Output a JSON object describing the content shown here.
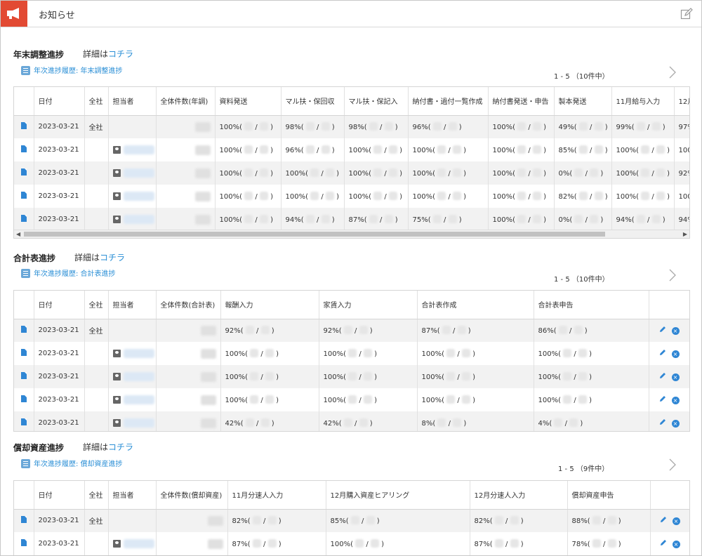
{
  "header": {
    "title": "お知らせ"
  },
  "sections": [
    {
      "title": "年末調整進捗",
      "detail_prefix": "詳細は",
      "detail_link": "コチラ",
      "history_link": "年次進捗履歴: 年末調整進捗",
      "pager": "1 - 5 （10件中）",
      "columns": [
        "日付",
        "全社",
        "担当者",
        "全体件数(年調)",
        "資料発送",
        "マル扶・保回収",
        "マル扶・保記入",
        "納付書・過付一覧作成",
        "納付書発送・申告",
        "製本発送",
        "11月給与入力",
        "12月"
      ],
      "rows": [
        {
          "date": "2023-03-21",
          "company": "全社",
          "values": [
            "100%",
            "98%",
            "98%",
            "96%",
            "100%",
            "49%",
            "99%",
            "97%"
          ]
        },
        {
          "date": "2023-03-21",
          "company": "",
          "values": [
            "100%",
            "96%",
            "100%",
            "100%",
            "100%",
            "85%",
            "100%",
            "100"
          ]
        },
        {
          "date": "2023-03-21",
          "company": "",
          "values": [
            "100%",
            "100%",
            "100%",
            "100%",
            "100%",
            "0%",
            "100%",
            "92%"
          ]
        },
        {
          "date": "2023-03-21",
          "company": "",
          "values": [
            "100%",
            "100%",
            "100%",
            "100%",
            "100%",
            "82%",
            "100%",
            "100"
          ]
        },
        {
          "date": "2023-03-21",
          "company": "",
          "values": [
            "100%",
            "94%",
            "87%",
            "75%",
            "100%",
            "0%",
            "94%",
            "94%"
          ]
        }
      ]
    },
    {
      "title": "合計表進捗",
      "detail_prefix": "詳細は",
      "detail_link": "コチラ",
      "history_link": "年次進捗履歴: 合計表進捗",
      "pager": "1 - 5 （10件中）",
      "columns": [
        "日付",
        "全社",
        "担当者",
        "全体件数(合計表)",
        "報酬入力",
        "家賃入力",
        "合計表作成",
        "合計表申告"
      ],
      "rows": [
        {
          "date": "2023-03-21",
          "company": "全社",
          "values": [
            "92%",
            "92%",
            "87%",
            "86%"
          ]
        },
        {
          "date": "2023-03-21",
          "company": "",
          "values": [
            "100%",
            "100%",
            "100%",
            "100%"
          ]
        },
        {
          "date": "2023-03-21",
          "company": "",
          "values": [
            "100%",
            "100%",
            "100%",
            "100%"
          ]
        },
        {
          "date": "2023-03-21",
          "company": "",
          "values": [
            "100%",
            "100%",
            "100%",
            "100%"
          ]
        },
        {
          "date": "2023-03-21",
          "company": "",
          "values": [
            "42%",
            "42%",
            "8%",
            "4%"
          ]
        }
      ]
    },
    {
      "title": "償却資産進捗",
      "detail_prefix": "詳細は",
      "detail_link": "コチラ",
      "history_link": "年次進捗履歴: 償却資産進捗",
      "pager": "1 - 5 （9件中）",
      "columns": [
        "日付",
        "全社",
        "担当者",
        "全体件数(償却資産)",
        "11月分速人入力",
        "12月購入資産ヒアリング",
        "12月分速人入力",
        "償却資産申告"
      ],
      "rows": [
        {
          "date": "2023-03-21",
          "company": "全社",
          "values": [
            "82%",
            "85%",
            "82%",
            "88%"
          ]
        },
        {
          "date": "2023-03-21",
          "company": "",
          "values": [
            "87%",
            "100%",
            "87%",
            "78%"
          ]
        }
      ]
    }
  ]
}
